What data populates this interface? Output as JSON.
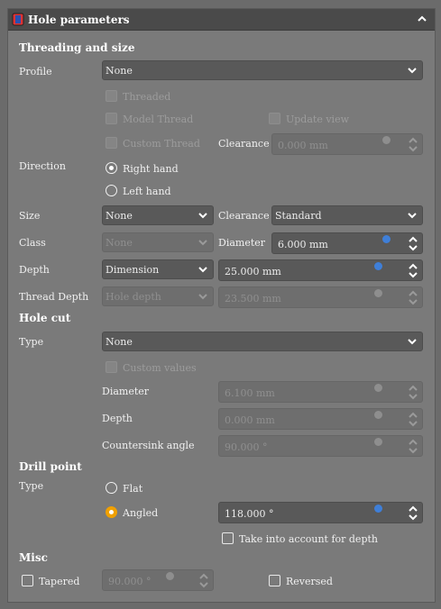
{
  "panel": {
    "title": "Hole parameters"
  },
  "threading": {
    "section_title": "Threading and size",
    "profile_label": "Profile",
    "profile_value": "None",
    "threaded_label": "Threaded",
    "model_thread_label": "Model Thread",
    "update_view_label": "Update view",
    "custom_thread_label": "Custom Thread",
    "clearance_label": "Clearance",
    "clearance_value": "0.000 mm",
    "direction_label": "Direction",
    "right_hand_label": "Right hand",
    "left_hand_label": "Left hand",
    "size_label": "Size",
    "size_value": "None",
    "clearance2_label": "Clearance",
    "clearance2_value": "Standard",
    "class_label": "Class",
    "class_value": "None",
    "diameter_label": "Diameter",
    "diameter_value": "6.000 mm",
    "depth_label": "Depth",
    "depth_type_value": "Dimension",
    "depth_value": "25.000 mm",
    "thread_depth_label": "Thread Depth",
    "thread_depth_type_value": "Hole depth",
    "thread_depth_value": "23.500 mm"
  },
  "hole_cut": {
    "section_title": "Hole cut",
    "type_label": "Type",
    "type_value": "None",
    "custom_values_label": "Custom values",
    "diameter_label": "Diameter",
    "diameter_value": "6.100 mm",
    "depth_label": "Depth",
    "depth_value": "0.000 mm",
    "countersink_label": "Countersink angle",
    "countersink_value": "90.000 °"
  },
  "drill_point": {
    "section_title": "Drill point",
    "type_label": "Type",
    "flat_label": "Flat",
    "angled_label": "Angled",
    "angle_value": "118.000 °",
    "take_into_account_label": "Take into account for depth"
  },
  "misc": {
    "section_title": "Misc",
    "tapered_label": "Tapered",
    "tapered_value": "90.000 °",
    "reversed_label": "Reversed"
  },
  "colors": {
    "background": "#6b6b6b",
    "panel": "#7a7a7a",
    "field": "#595959",
    "accent": "#f0a000"
  }
}
